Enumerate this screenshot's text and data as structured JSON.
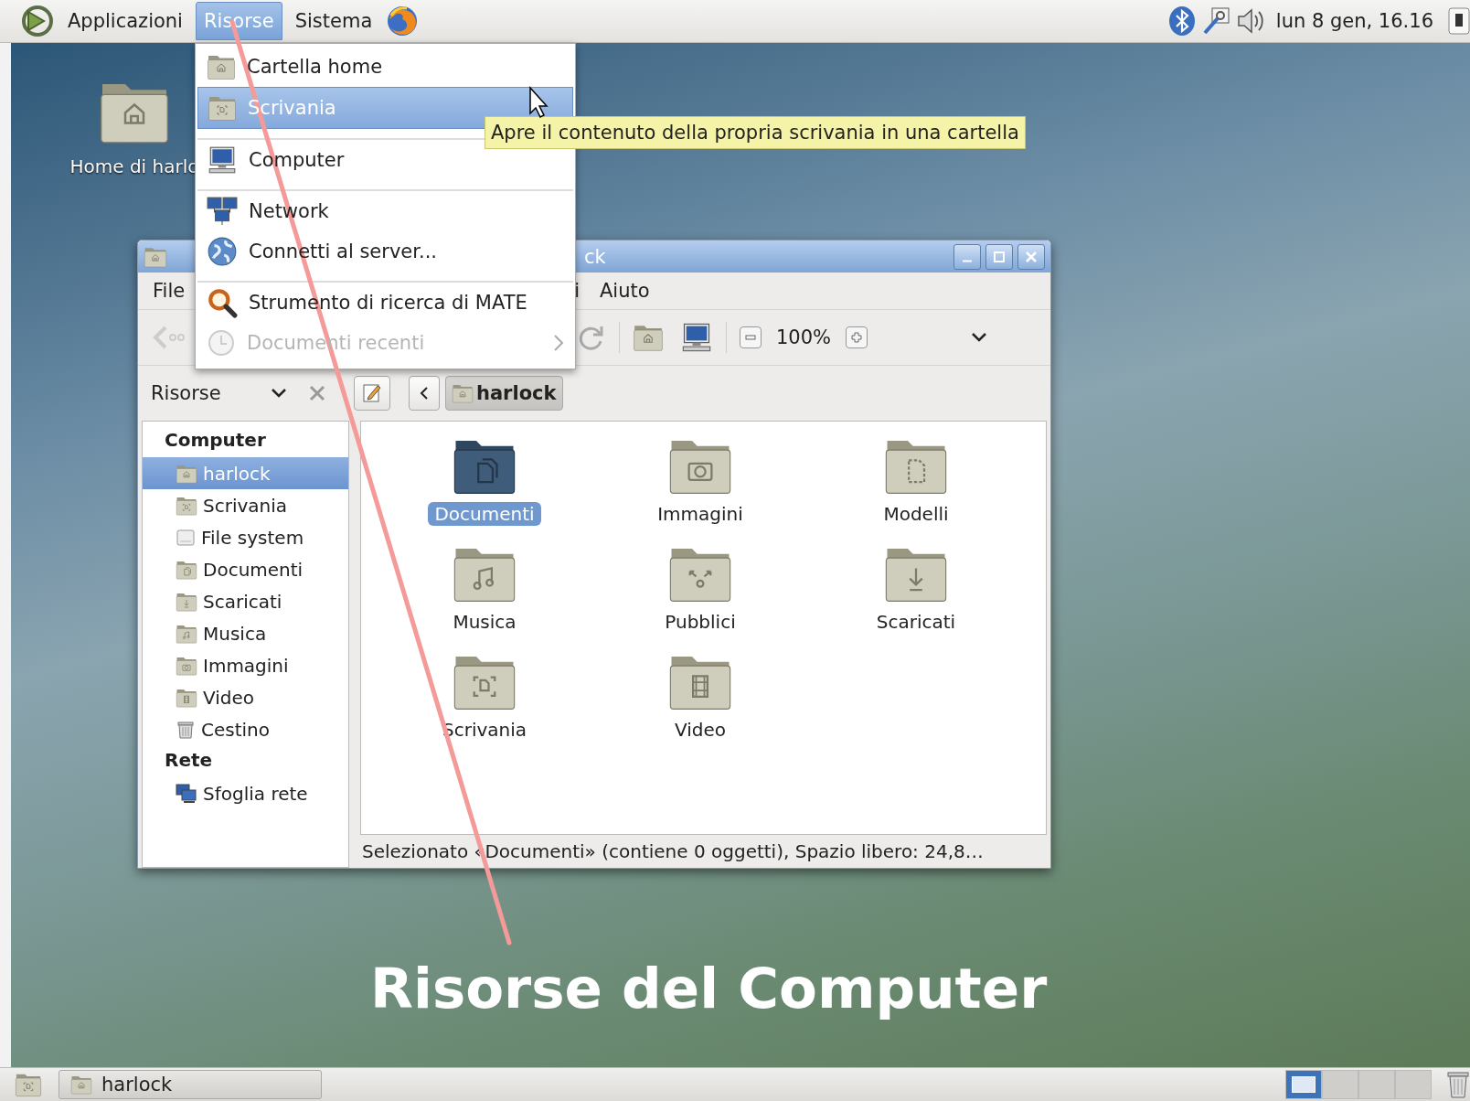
{
  "top_panel": {
    "menus": [
      {
        "label": "Applicazioni",
        "selected": false
      },
      {
        "label": "Risorse",
        "selected": true
      },
      {
        "label": "Sistema",
        "selected": false
      }
    ],
    "clock": "lun  8 gen, 16.16"
  },
  "desktop_icons": [
    {
      "label": "Home di harlo"
    }
  ],
  "places_menu": {
    "items": [
      {
        "label": "Cartella home",
        "selected": false,
        "disabled": false,
        "separated": false,
        "submenu": false
      },
      {
        "label": "Scrivania",
        "selected": true,
        "disabled": false,
        "separated": false,
        "submenu": false
      },
      {
        "label": "Computer",
        "selected": false,
        "disabled": false,
        "separated": true,
        "submenu": false
      },
      {
        "label": "Network",
        "selected": false,
        "disabled": false,
        "separated": true,
        "submenu": false
      },
      {
        "label": "Connetti al server...",
        "selected": false,
        "disabled": false,
        "separated": false,
        "submenu": false
      },
      {
        "label": "Strumento di ricerca di MATE",
        "selected": false,
        "disabled": false,
        "separated": true,
        "submenu": false
      },
      {
        "label": "Documenti recenti",
        "selected": false,
        "disabled": true,
        "separated": false,
        "submenu": true
      }
    ]
  },
  "tooltip": "Apre il contenuto della propria scrivania in una cartella",
  "file_manager": {
    "title": "ck",
    "menus": [
      "File",
      "i",
      "Aiuto"
    ],
    "zoom": "100%",
    "pane_title": "Risorse",
    "path": "harlock",
    "sidebar": [
      {
        "heading": "Computer",
        "items": [
          {
            "label": "harlock",
            "selected": true
          },
          {
            "label": "Scrivania",
            "selected": false
          },
          {
            "label": "File system",
            "selected": false
          },
          {
            "label": "Documenti",
            "selected": false
          },
          {
            "label": "Scaricati",
            "selected": false
          },
          {
            "label": "Musica",
            "selected": false
          },
          {
            "label": "Immagini",
            "selected": false
          },
          {
            "label": "Video",
            "selected": false
          },
          {
            "label": "Cestino",
            "selected": false
          }
        ]
      },
      {
        "heading": "Rete",
        "items": [
          {
            "label": "Sfoglia rete",
            "selected": false
          }
        ]
      }
    ],
    "files": [
      {
        "name": "Documenti",
        "selected": true
      },
      {
        "name": "Immagini",
        "selected": false
      },
      {
        "name": "Modelli",
        "selected": false
      },
      {
        "name": "Musica",
        "selected": false
      },
      {
        "name": "Pubblici",
        "selected": false
      },
      {
        "name": "Scaricati",
        "selected": false
      },
      {
        "name": "Scrivania",
        "selected": false
      },
      {
        "name": "Video",
        "selected": false
      }
    ],
    "status": "Selezionato «Documenti» (contiene 0 oggetti), Spazio libero: 24,8…"
  },
  "taskbar": {
    "windows": [
      {
        "label": "harlock",
        "selected": false
      }
    ],
    "workspaces": [
      {
        "selected": true
      },
      {
        "selected": false
      },
      {
        "selected": false
      },
      {
        "selected": false
      }
    ]
  },
  "caption": "Risorse del Computer"
}
